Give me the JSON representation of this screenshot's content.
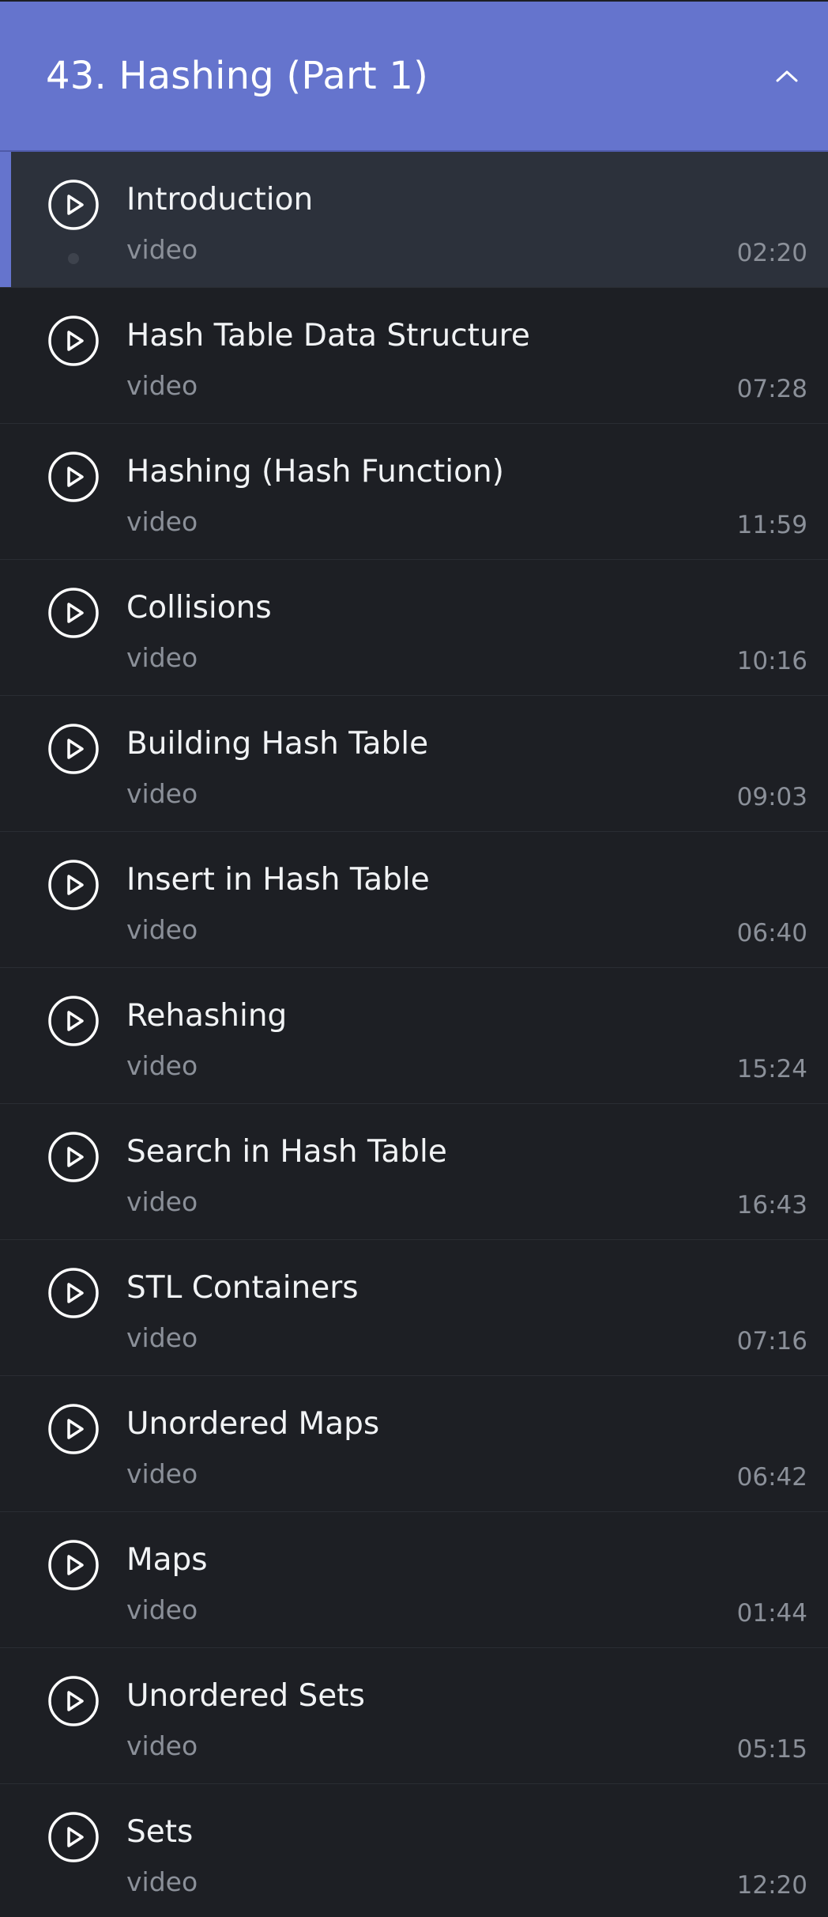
{
  "section": {
    "title": "43. Hashing (Part 1)",
    "collapse_icon": "chevron-up-icon",
    "accent_color": "#6574cd"
  },
  "lessons": [
    {
      "title": "Introduction",
      "type": "video",
      "duration": "02:20",
      "active": true
    },
    {
      "title": "Hash Table Data Structure",
      "type": "video",
      "duration": "07:28"
    },
    {
      "title": "Hashing (Hash Function)",
      "type": "video",
      "duration": "11:59"
    },
    {
      "title": "Collisions",
      "type": "video",
      "duration": "10:16"
    },
    {
      "title": "Building Hash Table",
      "type": "video",
      "duration": "09:03"
    },
    {
      "title": "Insert in Hash Table",
      "type": "video",
      "duration": "06:40"
    },
    {
      "title": "Rehashing",
      "type": "video",
      "duration": "15:24"
    },
    {
      "title": "Search in Hash Table",
      "type": "video",
      "duration": "16:43"
    },
    {
      "title": "STL Containers",
      "type": "video",
      "duration": "07:16"
    },
    {
      "title": "Unordered Maps",
      "type": "video",
      "duration": "06:42"
    },
    {
      "title": "Maps",
      "type": "video",
      "duration": "01:44"
    },
    {
      "title": "Unordered Sets",
      "type": "video",
      "duration": "05:15"
    },
    {
      "title": "Sets",
      "type": "video",
      "duration": "12:20"
    }
  ],
  "icons": {
    "play": "play-circle-icon"
  }
}
